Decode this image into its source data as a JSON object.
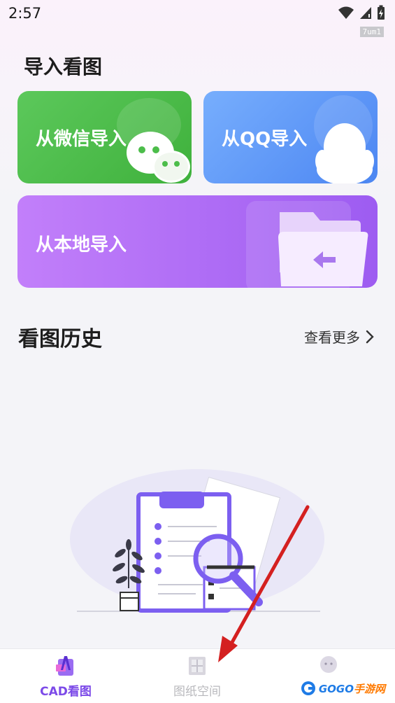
{
  "status_bar": {
    "time": "2:57",
    "tag": "7um1",
    "icons": [
      "wifi-icon",
      "signal-icon",
      "battery-charging-icon"
    ]
  },
  "import_section": {
    "title": "导入看图",
    "wechat_label": "从微信导入",
    "qq_label": "从QQ导入",
    "local_label": "从本地导入"
  },
  "history_section": {
    "title": "看图历史",
    "more_label": "查看更多"
  },
  "bottom_nav": {
    "items": [
      {
        "label": "CAD看图",
        "icon": "cad-icon",
        "active": true
      },
      {
        "label": "图纸空间",
        "icon": "drawing-icon",
        "active": false
      },
      {
        "label": "",
        "icon": "avatar-icon",
        "active": false
      }
    ]
  },
  "watermark": {
    "brand_main": "GOGO",
    "brand_sub": "手游网"
  },
  "colors": {
    "accent": "#7c4ae8",
    "wechat_green": "#4cbd4a",
    "qq_blue": "#5f97f7",
    "local_purple": "#ae6df6",
    "annotation_arrow": "#d42020"
  }
}
